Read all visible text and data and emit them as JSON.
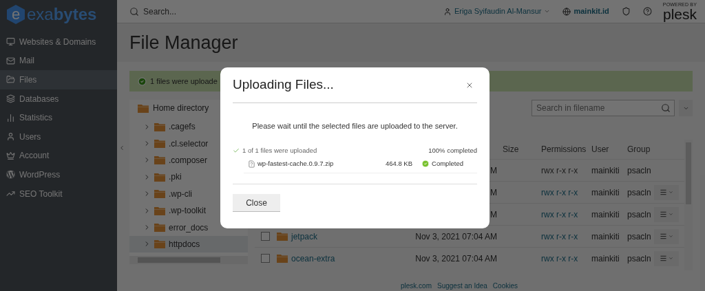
{
  "sidebar": {
    "logo": {
      "mark": "e",
      "light": "exa",
      "bold": "bytes"
    },
    "items": [
      {
        "label": "Websites & Domains",
        "selected": false
      },
      {
        "label": "Mail",
        "selected": false
      },
      {
        "label": "Files",
        "selected": true
      },
      {
        "label": "Databases",
        "selected": false
      },
      {
        "label": "Statistics",
        "selected": false
      },
      {
        "label": "Users",
        "selected": false
      },
      {
        "label": "Account",
        "selected": false
      },
      {
        "label": "WordPress",
        "selected": false
      },
      {
        "label": "SEO Toolkit",
        "selected": false
      }
    ]
  },
  "topbar": {
    "search": {
      "placeholder": "Search..."
    },
    "user": "Eriga Syifaudin Al-Mansur",
    "domain": "mainkit.id",
    "brand": {
      "tagline": "POWERED BY",
      "name": "plesk"
    }
  },
  "page": {
    "title": "File Manager",
    "alert": "1 files were uploade",
    "filter": {
      "placeholder": "Search in filename"
    }
  },
  "tree": {
    "label": "Home directory",
    "children": [
      {
        "label": ".cagefs",
        "selected": false
      },
      {
        "label": ".cl.selector",
        "selected": false
      },
      {
        "label": ".composer",
        "selected": false
      },
      {
        "label": ".pki",
        "selected": false
      },
      {
        "label": ".wp-cli",
        "selected": false
      },
      {
        "label": ".wp-toolkit",
        "selected": false
      },
      {
        "label": "error_docs",
        "selected": false
      },
      {
        "label": "httpdocs",
        "selected": true
      }
    ]
  },
  "table": {
    "columns": [
      "Size",
      "Permissions",
      "User",
      "Group"
    ],
    "rows": [
      {
        "modified": "M",
        "permissions": "rwx r-x r-x",
        "permissions_link": false,
        "user": "mainkiti",
        "group": "psacln",
        "menu": false
      },
      {
        "modified": "M",
        "permissions": "rwx r-x r-x",
        "permissions_link": true,
        "user": "mainkiti",
        "group": "psacln",
        "menu": true
      },
      {
        "modified": "M",
        "permissions": "rwx r-x r-x",
        "permissions_link": true,
        "user": "mainkiti",
        "group": "psacln",
        "menu": true
      },
      {
        "checked": false,
        "name": "jetpack",
        "modified": "Nov 3, 2021 07:04 AM",
        "permissions": "rwx r-x r-x",
        "permissions_link": true,
        "user": "mainkiti",
        "group": "psacln",
        "menu": true
      },
      {
        "checked": false,
        "name": "ocean-extra",
        "modified": "Nov 3, 2021 07:04 AM",
        "permissions": "rwx r-x r-x",
        "permissions_link": true,
        "user": "mainkiti",
        "group": "psacln",
        "menu": true
      }
    ]
  },
  "modal": {
    "title": "Uploading Files...",
    "message": "Please wait until the selected files are uploaded to the server.",
    "summary": "1 of 1 files were uploaded",
    "progress": "100% completed",
    "files": [
      {
        "name": "wp-fastest-cache.0.9.7.zip",
        "size": "464.8 KB",
        "status": "Completed",
        "done": true
      }
    ],
    "button": "Close"
  },
  "footer": [
    "plesk.com",
    "Suggest an Idea",
    "Cookies"
  ]
}
